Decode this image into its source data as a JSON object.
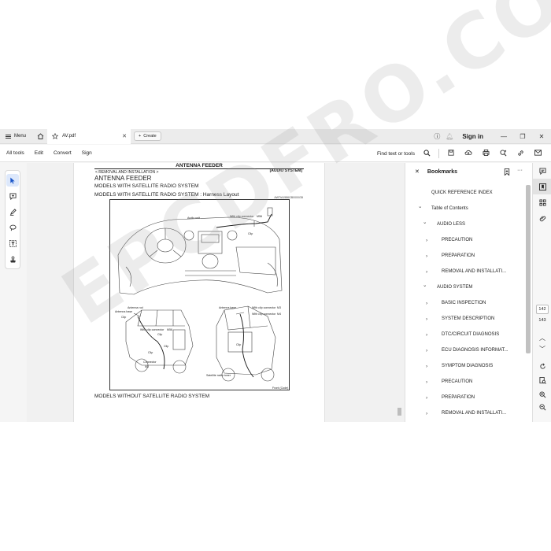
{
  "titlebar": {
    "menu_label": "Menu",
    "tab_title": "AV.pdf",
    "create_label": "Create",
    "signin_label": "Sign in"
  },
  "toolbar": {
    "items": [
      "All tools",
      "Edit",
      "Convert",
      "Sign"
    ],
    "find_label": "Find text or tools"
  },
  "document": {
    "page_title": "ANTENNA FEEDER",
    "breadcrumb": "< REMOVAL AND INSTALLATION >",
    "system_tag": "[AUDIO SYSTEM]",
    "heading": "ANTENNA FEEDER",
    "subheading_1": "MODELS WITH SATELLITE RADIO SYSTEM",
    "subheading_2": "MODELS WITH SATELLITE RADIO SYSTEM : Harness Layout",
    "figure_code": "AWTIA1586GB0000GB",
    "subheading_3": "MODELS WITHOUT SATELLITE RADIO SYSTEM",
    "diagram_labels": {
      "audio_unit": "Audio unit",
      "with_clip_connector_top": "With clip connector",
      "clip_top": "Clip",
      "antenna_rod": "Antenna rod",
      "antenna_base": "Antenna base",
      "clip_l1": "Clip",
      "with_clip_connector_l": "With clip connector",
      "clip_l2": "Clip",
      "clip_l3": "Clip",
      "clip_l4": "Clip",
      "connector": "Connector",
      "antenna_base_r": "Antenna base",
      "with_clip_connector_r1": "With clip connector",
      "with_clip_connector_r2": "With clip connector",
      "clip_r": "Clip",
      "satellite_radio_tuner": "Satellite radio tuner",
      "front_code": "Front (Code)",
      "m_top": "M56",
      "m_l": "M56",
      "m_l2": "M3",
      "m_r1": "M3",
      "m_r2": "M4"
    }
  },
  "bookmarks": {
    "title": "Bookmarks",
    "items": [
      {
        "label": "QUICK REFERENCE INDEX",
        "level": 0,
        "chevron": ""
      },
      {
        "label": "Table of Contents",
        "level": 0,
        "chevron": "v"
      },
      {
        "label": "AUDIO LESS",
        "level": 1,
        "chevron": "v"
      },
      {
        "label": "PRECAUTION",
        "level": 2,
        "chevron": ">"
      },
      {
        "label": "PREPARATION",
        "level": 2,
        "chevron": ">"
      },
      {
        "label": "REMOVAL AND INSTALLATI...",
        "level": 2,
        "chevron": ">"
      },
      {
        "label": "AUDIO SYSTEM",
        "level": 1,
        "chevron": "v"
      },
      {
        "label": "BASIC INSPECTION",
        "level": 2,
        "chevron": ">"
      },
      {
        "label": "SYSTEM DESCRIPTION",
        "level": 2,
        "chevron": ">"
      },
      {
        "label": "DTC/CIRCUIT DIAGNOSIS",
        "level": 2,
        "chevron": ">"
      },
      {
        "label": "ECU DIAGNOSIS INFORMAT...",
        "level": 2,
        "chevron": ">"
      },
      {
        "label": "SYMPTOM DIAGNOSIS",
        "level": 2,
        "chevron": ">"
      },
      {
        "label": "PRECAUTION",
        "level": 2,
        "chevron": ">"
      },
      {
        "label": "PREPARATION",
        "level": 2,
        "chevron": ">"
      },
      {
        "label": "REMOVAL AND INSTALLATI...",
        "level": 2,
        "chevron": ">"
      }
    ]
  },
  "pagenav": {
    "current_page": "142",
    "total_pages": "143"
  },
  "watermark": "EPCDFRO.COM",
  "colors": {
    "accent": "#1a56c9",
    "active_tool_bg": "#dde8fb"
  }
}
